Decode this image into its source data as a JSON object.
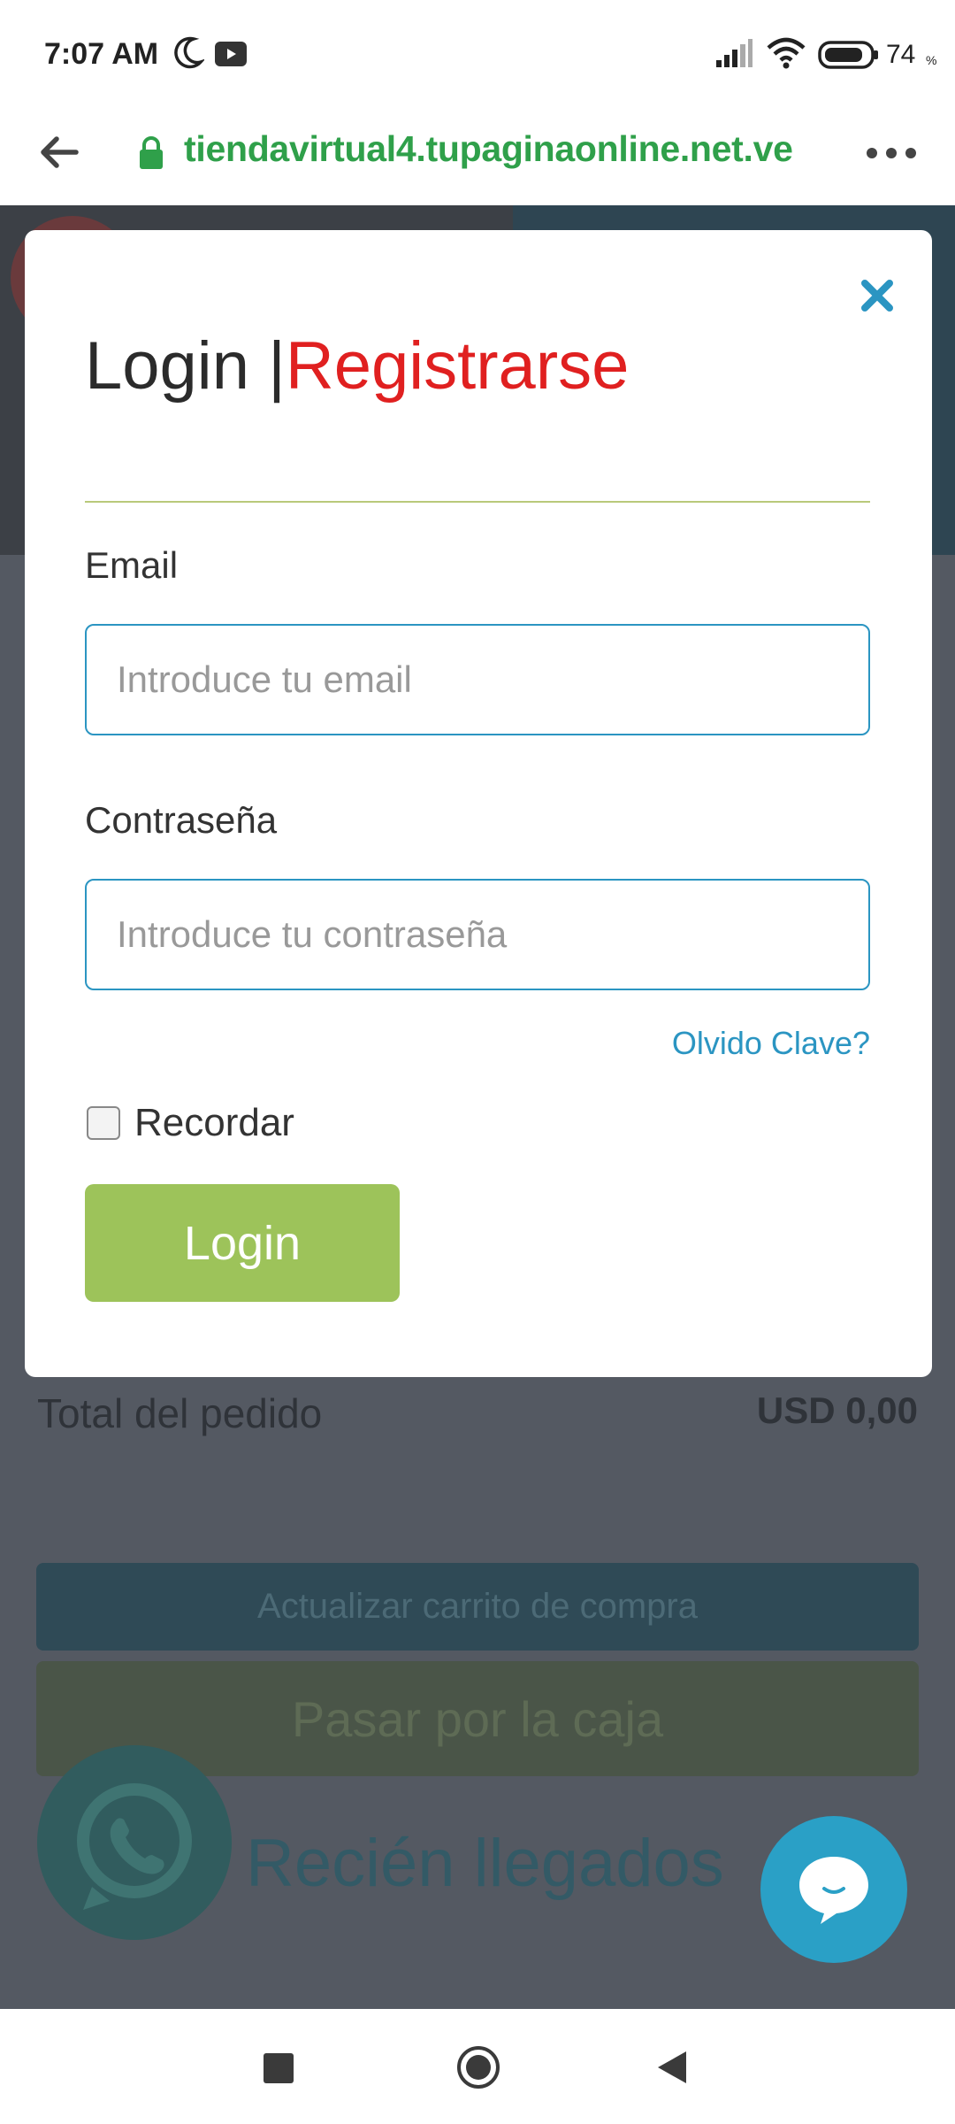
{
  "status_bar": {
    "time": "7:07 AM",
    "battery": "74",
    "battery_unit": "%",
    "icons": [
      "moon-icon",
      "youtube-icon",
      "signal-icon",
      "wifi-icon",
      "battery-icon"
    ]
  },
  "browser": {
    "url": "tiendavirtual4.tupaginaonline.net.ve",
    "icons": [
      "back-arrow-icon",
      "lock-icon",
      "more-icon"
    ]
  },
  "background_page": {
    "total_label": "Total del pedido",
    "total_value": "USD 0,00",
    "update_button": "Actualizar carrito de compra",
    "checkout_button": "Pasar por la caja",
    "section_title": "Recién llegados"
  },
  "modal": {
    "title_login": "Login ",
    "title_separator": "|",
    "title_register": "Registrarse",
    "email_label": "Email",
    "email_placeholder": "Introduce tu email",
    "email_value": "",
    "password_label": "Contraseña",
    "password_placeholder": "Introduce tu contraseña",
    "password_value": "",
    "forgot_link": "Olvido Clave?",
    "remember_label": "Recordar",
    "remember_checked": false,
    "login_button": "Login"
  },
  "colors": {
    "accent_blue": "#2b95c2",
    "register_red": "#e02020",
    "login_green": "#9dc35a",
    "url_green": "#2fa04a",
    "overlay": "#545962"
  }
}
